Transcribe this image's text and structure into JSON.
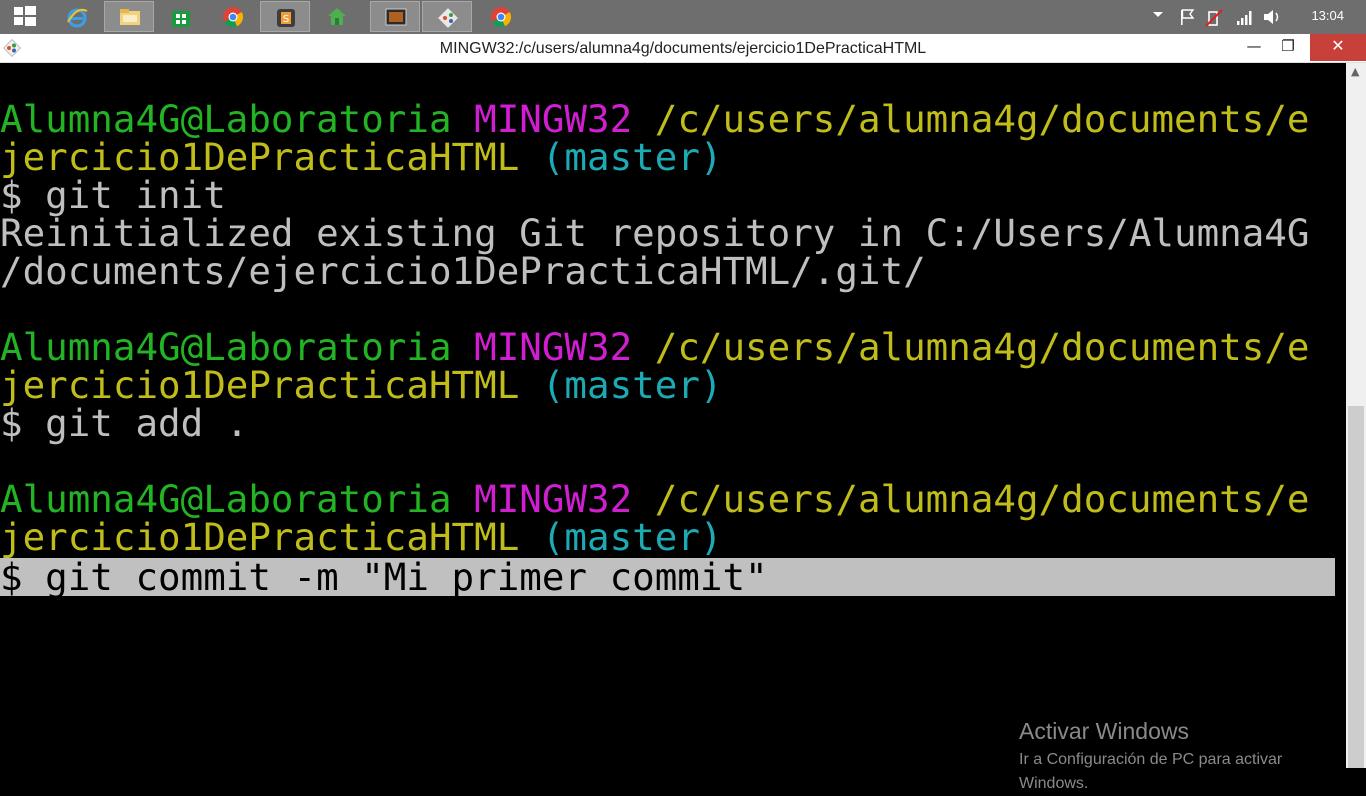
{
  "taskbar": {
    "apps": [
      {
        "name": "internet-explorer-icon",
        "active": false
      },
      {
        "name": "file-explorer-icon",
        "active": true
      },
      {
        "name": "store-icon",
        "active": false
      },
      {
        "name": "chrome-icon",
        "active": false
      },
      {
        "name": "sublime-text-icon",
        "active": true
      },
      {
        "name": "sourcetree-icon",
        "active": false
      },
      {
        "name": "terminal-icon",
        "active": true
      },
      {
        "name": "git-bash-icon",
        "active": true
      },
      {
        "name": "chrome-alt-icon",
        "active": false
      }
    ],
    "clock": "13:04"
  },
  "window": {
    "title": "MINGW32:/c/users/alumna4g/documents/ejercicio1DePracticaHTML",
    "minimize": "—",
    "maximize": "❐",
    "close": "✕"
  },
  "terminal": {
    "colors": {
      "user": "#23b423",
      "system": "#d21ed2",
      "path": "#c0bd1a",
      "branch": "#1cabb5",
      "output": "#bfbfbf"
    },
    "blocks": [
      {
        "user": "Alumna4G@Laboratoria",
        "system": "MINGW32",
        "path_part1": "/c/users/alumna4g/documents/e",
        "path_part2": "jercicio1DePracticaHTML",
        "branch": "(master)",
        "command": "$ git init",
        "output": [
          "Reinitialized existing Git repository in C:/Users/Alumna4G",
          "/documents/ejercicio1DePracticaHTML/.git/"
        ]
      },
      {
        "user": "Alumna4G@Laboratoria",
        "system": "MINGW32",
        "path_part1": "/c/users/alumna4g/documents/e",
        "path_part2": "jercicio1DePracticaHTML",
        "branch": "(master)",
        "command": "$ git add ."
      },
      {
        "user": "Alumna4G@Laboratoria",
        "system": "MINGW32",
        "path_part1": "/c/users/alumna4g/documents/e",
        "path_part2": "jercicio1DePracticaHTML",
        "branch": "(master)",
        "command": "$ git commit -m \"Mi primer commit\""
      }
    ]
  },
  "watermark": {
    "title": "Activar Windows",
    "subtitle": "Ir a Configuración de PC para activar Windows."
  }
}
